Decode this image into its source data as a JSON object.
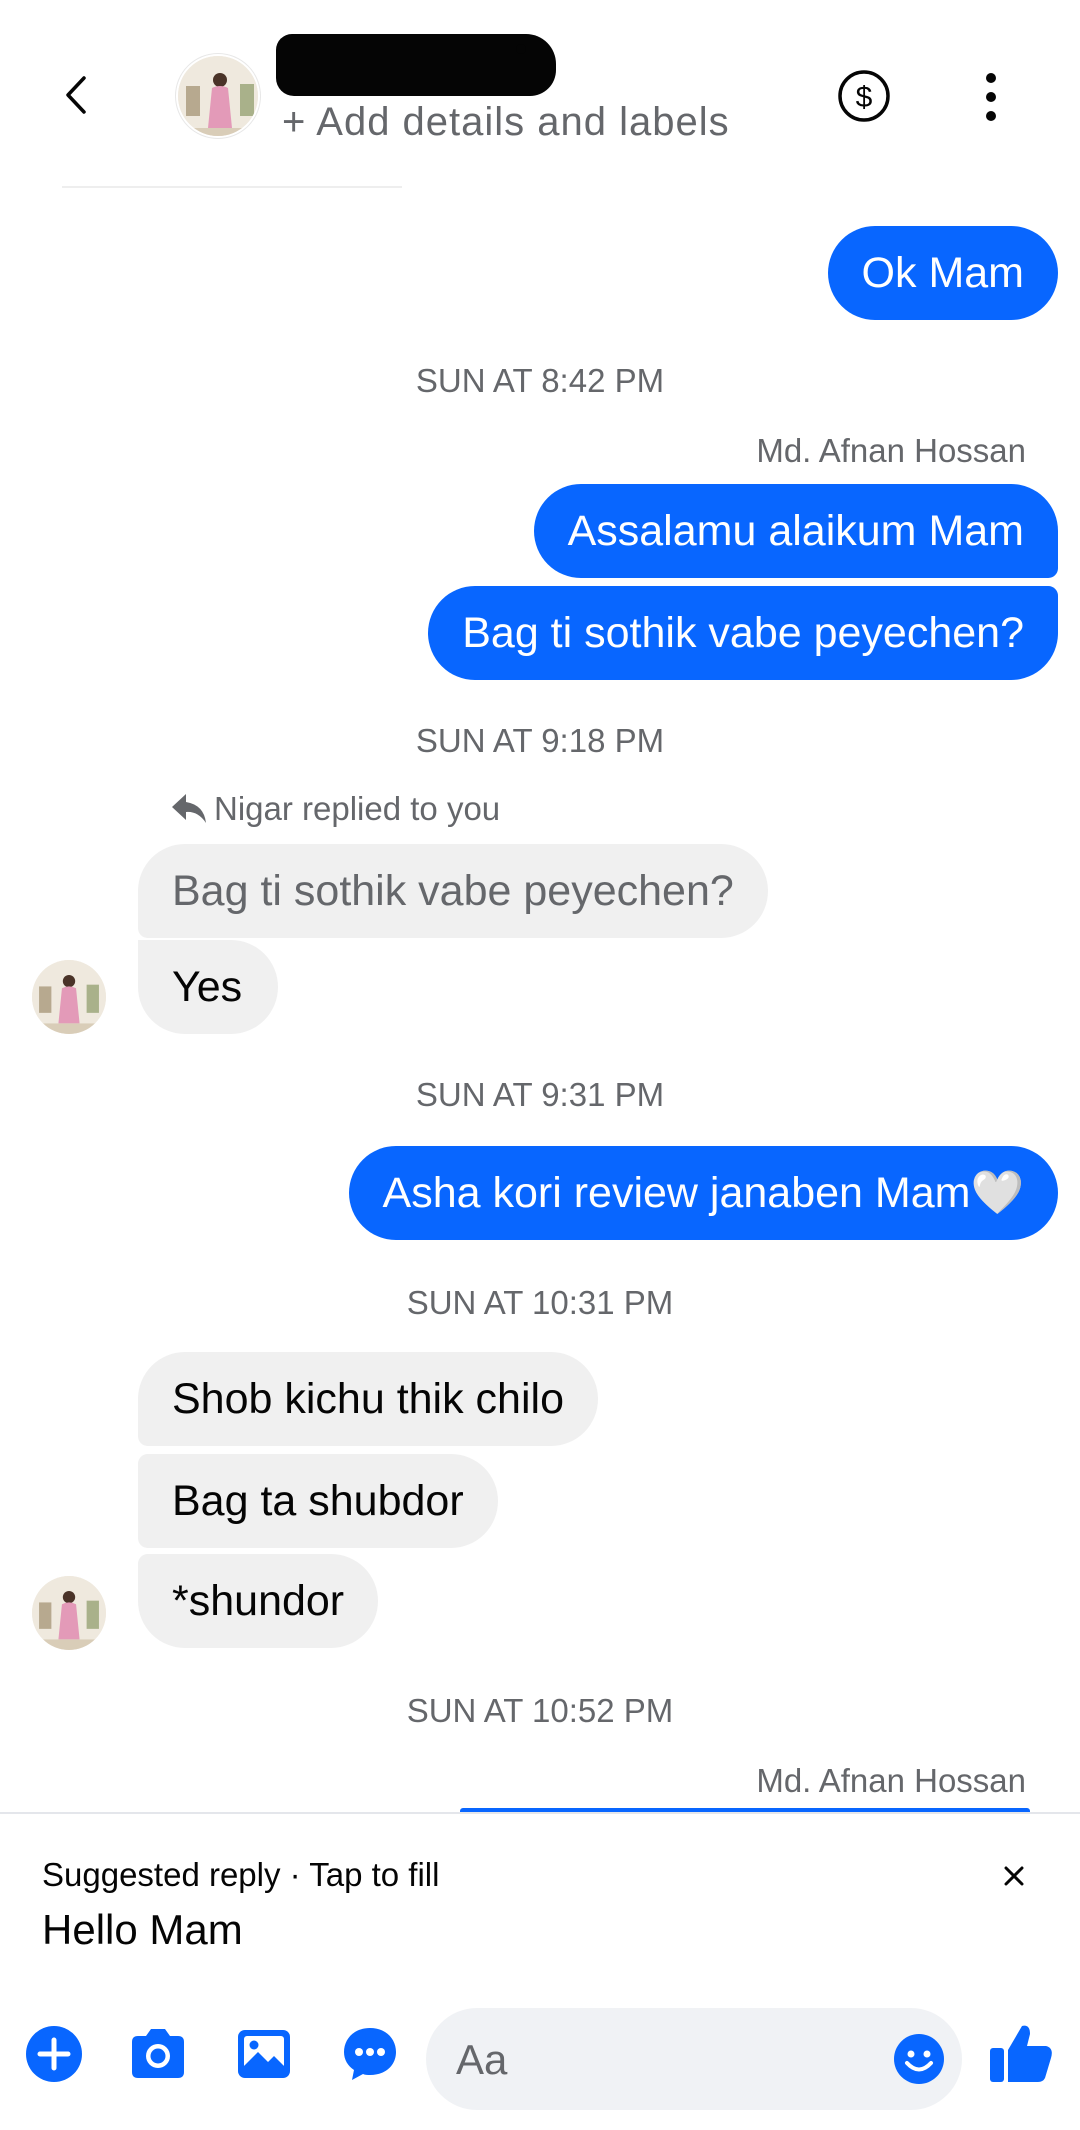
{
  "header": {
    "add_details": "+ Add details and labels",
    "back_icon": "chevron-left-icon",
    "payment_icon": "dollar-circle-icon",
    "more_icon": "vertical-dots-icon"
  },
  "colors": {
    "accent": "#0866ff",
    "incoming_bubble": "#f0f0f0",
    "secondary_text": "#65676b"
  },
  "messages": [
    {
      "type": "outgoing",
      "text": "Ok Mam"
    },
    {
      "type": "timestamp",
      "text": "SUN AT 8:42 PM"
    },
    {
      "type": "sender",
      "text": "Md. Afnan Hossan"
    },
    {
      "type": "outgoing",
      "text": "Assalamu alaikum Mam"
    },
    {
      "type": "outgoing",
      "text": "Bag ti sothik vabe peyechen?"
    },
    {
      "type": "timestamp",
      "text": "SUN AT 9:18 PM"
    },
    {
      "type": "reply_label",
      "text": "Nigar replied to you"
    },
    {
      "type": "quoted",
      "text": "Bag ti sothik vabe peyechen?"
    },
    {
      "type": "incoming",
      "text": "Yes"
    },
    {
      "type": "timestamp",
      "text": "SUN AT 9:31 PM"
    },
    {
      "type": "outgoing",
      "text": "Asha kori review janaben Mam🤍"
    },
    {
      "type": "timestamp",
      "text": "SUN AT 10:31 PM"
    },
    {
      "type": "incoming",
      "text": "Shob kichu thik chilo"
    },
    {
      "type": "incoming",
      "text": "Bag ta shubdor"
    },
    {
      "type": "incoming",
      "text": "*shundor"
    },
    {
      "type": "timestamp",
      "text": "SUN AT 10:52 PM"
    },
    {
      "type": "sender",
      "text": "Md. Afnan Hossan"
    }
  ],
  "suggested_reply": {
    "heading": "Suggested reply · Tap to fill",
    "text": "Hello Mam"
  },
  "composer": {
    "placeholder": "Aa",
    "icons": [
      "plus-circle-icon",
      "camera-icon",
      "gallery-icon",
      "chat-more-icon",
      "emoji-icon",
      "thumbs-up-icon"
    ]
  }
}
